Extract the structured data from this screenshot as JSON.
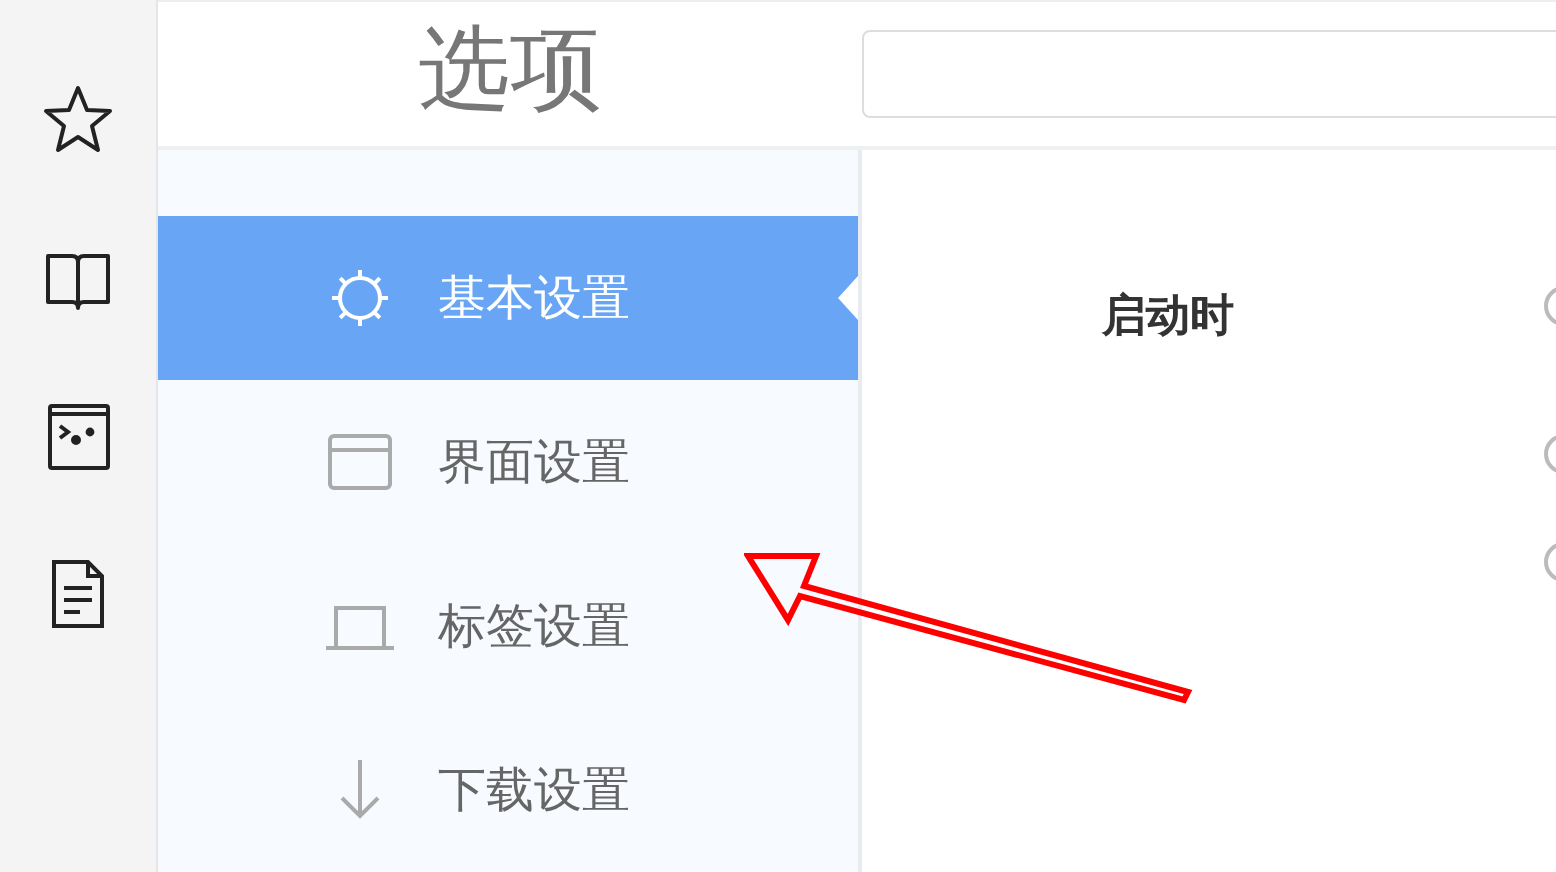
{
  "title": "选项",
  "toolbar": [
    {
      "kind": "star"
    },
    {
      "kind": "book"
    },
    {
      "kind": "terminal"
    },
    {
      "kind": "document"
    }
  ],
  "sidebar": {
    "items": [
      {
        "label": "基本设置",
        "kind": "gear",
        "selected": true
      },
      {
        "label": "界面设置",
        "kind": "window",
        "selected": false
      },
      {
        "label": "标签设置",
        "kind": "tab",
        "selected": false
      },
      {
        "label": "下载设置",
        "kind": "download",
        "selected": false
      }
    ]
  },
  "content": {
    "label": "启动时",
    "options": [
      {
        "selected": false
      },
      {
        "selected": false
      },
      {
        "selected": false
      }
    ]
  },
  "annotation": {
    "kind": "arrow"
  }
}
